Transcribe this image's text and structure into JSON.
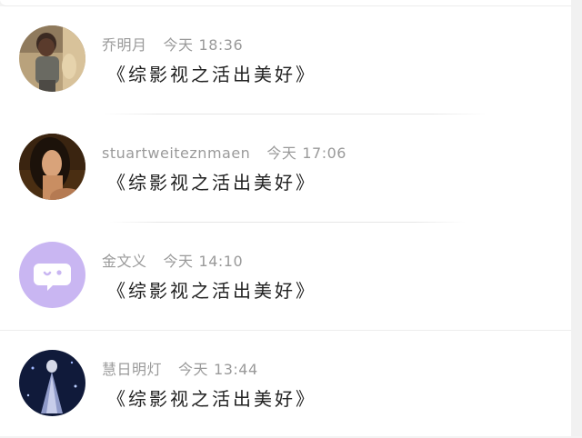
{
  "comments": [
    {
      "author": "乔明月",
      "day": "今天",
      "time": "18:36",
      "text": "《综影视之活出美好》",
      "avatar_icon": "child-photo-avatar"
    },
    {
      "author": "stuartweiteznmaen",
      "day": "今天",
      "time": "17:06",
      "text": "《综影视之活出美好》",
      "avatar_icon": "woman-portrait-avatar"
    },
    {
      "author": "金文义",
      "day": "今天",
      "time": "14:10",
      "text": "《综影视之活出美好》",
      "avatar_icon": "chat-bubble-avatar"
    },
    {
      "author": "慧日明灯",
      "day": "今天",
      "time": "13:44",
      "text": "《综影视之活出美好》",
      "avatar_icon": "night-figure-avatar"
    }
  ],
  "colors": {
    "meta_text": "#9a9a9a",
    "comment_text": "#222222",
    "default_avatar_bg": "#c9b6f2"
  }
}
